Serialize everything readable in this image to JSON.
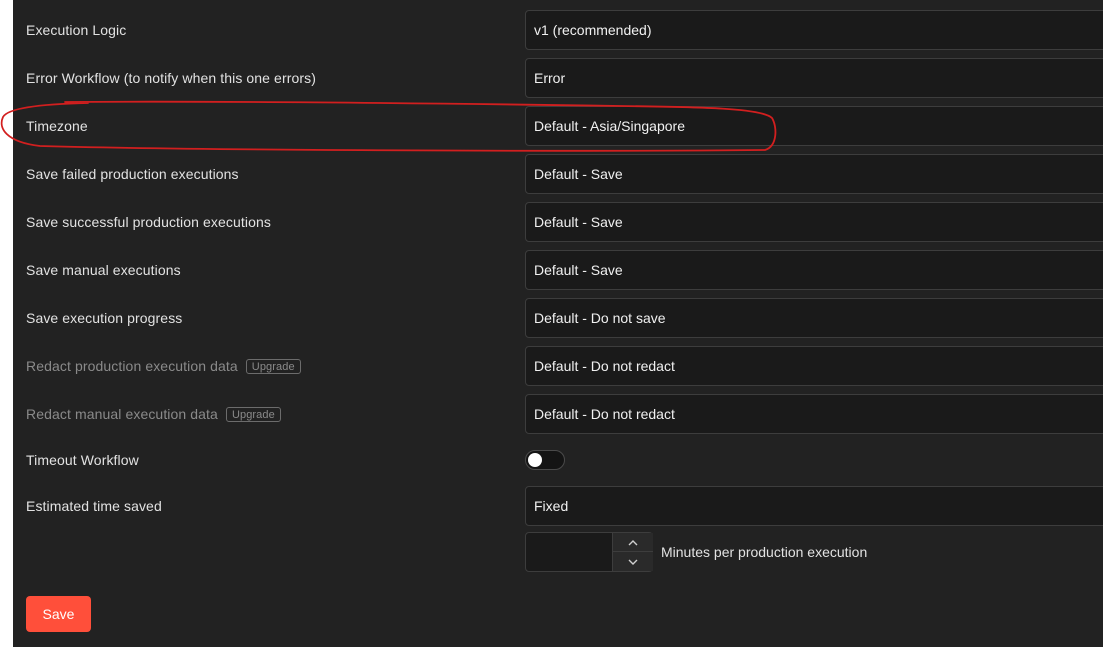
{
  "settings": {
    "rows": [
      {
        "label": "Execution Logic",
        "value": "v1 (recommended)"
      },
      {
        "label": "Error Workflow (to notify when this one errors)",
        "value": "Error"
      },
      {
        "label": "Timezone",
        "value": "Default - Asia/Singapore"
      },
      {
        "label": "Save failed production executions",
        "value": "Default - Save"
      },
      {
        "label": "Save successful production executions",
        "value": "Default - Save"
      },
      {
        "label": "Save manual executions",
        "value": "Default - Save"
      },
      {
        "label": "Save execution progress",
        "value": "Default - Do not save"
      },
      {
        "label": "Redact production execution data",
        "badge": "Upgrade",
        "value": "Default - Do not redact"
      },
      {
        "label": "Redact manual execution data",
        "badge": "Upgrade",
        "value": "Default - Do not redact"
      }
    ],
    "timeout": {
      "label": "Timeout Workflow",
      "enabled": false
    },
    "time_saved": {
      "label": "Estimated time saved",
      "mode": "Fixed",
      "minutes_value": "",
      "unit_label": "Minutes per production execution"
    },
    "save_label": "Save"
  },
  "icons": {
    "stepper_up": "chevron-up-icon",
    "stepper_down": "chevron-down-icon"
  },
  "colors": {
    "panel_background": "#222222",
    "save_button": "#ff4f3a",
    "annotation_circle": "#d21f1f"
  }
}
